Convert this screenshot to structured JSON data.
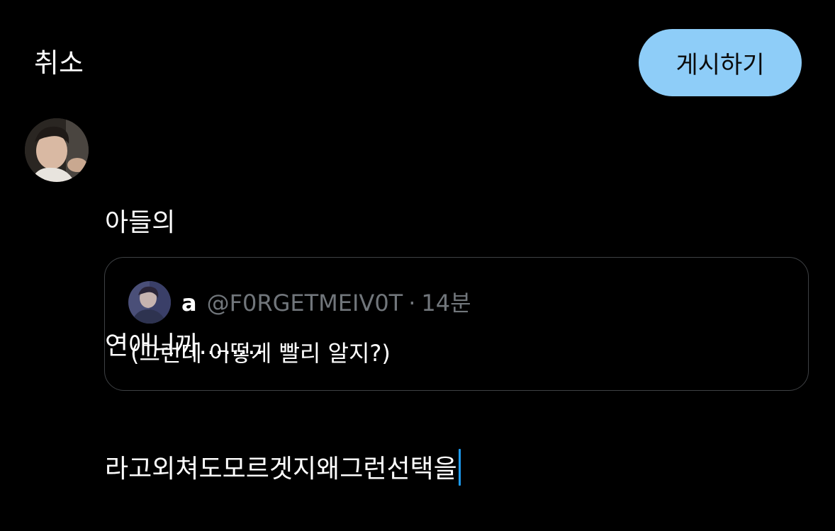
{
  "header": {
    "cancel_label": "취소",
    "post_label": "게시하기"
  },
  "compose": {
    "lines": [
      "아들의",
      "연애니까........",
      "라고외쳐도모르겟지왜그런선택을"
    ]
  },
  "quoted_tweet": {
    "display_name": "a",
    "handle": "@F0RGETMEIV0T",
    "separator": "·",
    "time": "14분",
    "text": "(그런데 어떻게 빨리 알지?)"
  },
  "colors": {
    "background": "#000000",
    "post_button": "#8ecdf8",
    "caret": "#1d9bf0",
    "muted_text": "#71767b",
    "card_border": "#3e4144"
  },
  "icons": {
    "user_avatar": "user-avatar-photo",
    "quoted_avatar": "quoted-user-avatar-photo"
  }
}
